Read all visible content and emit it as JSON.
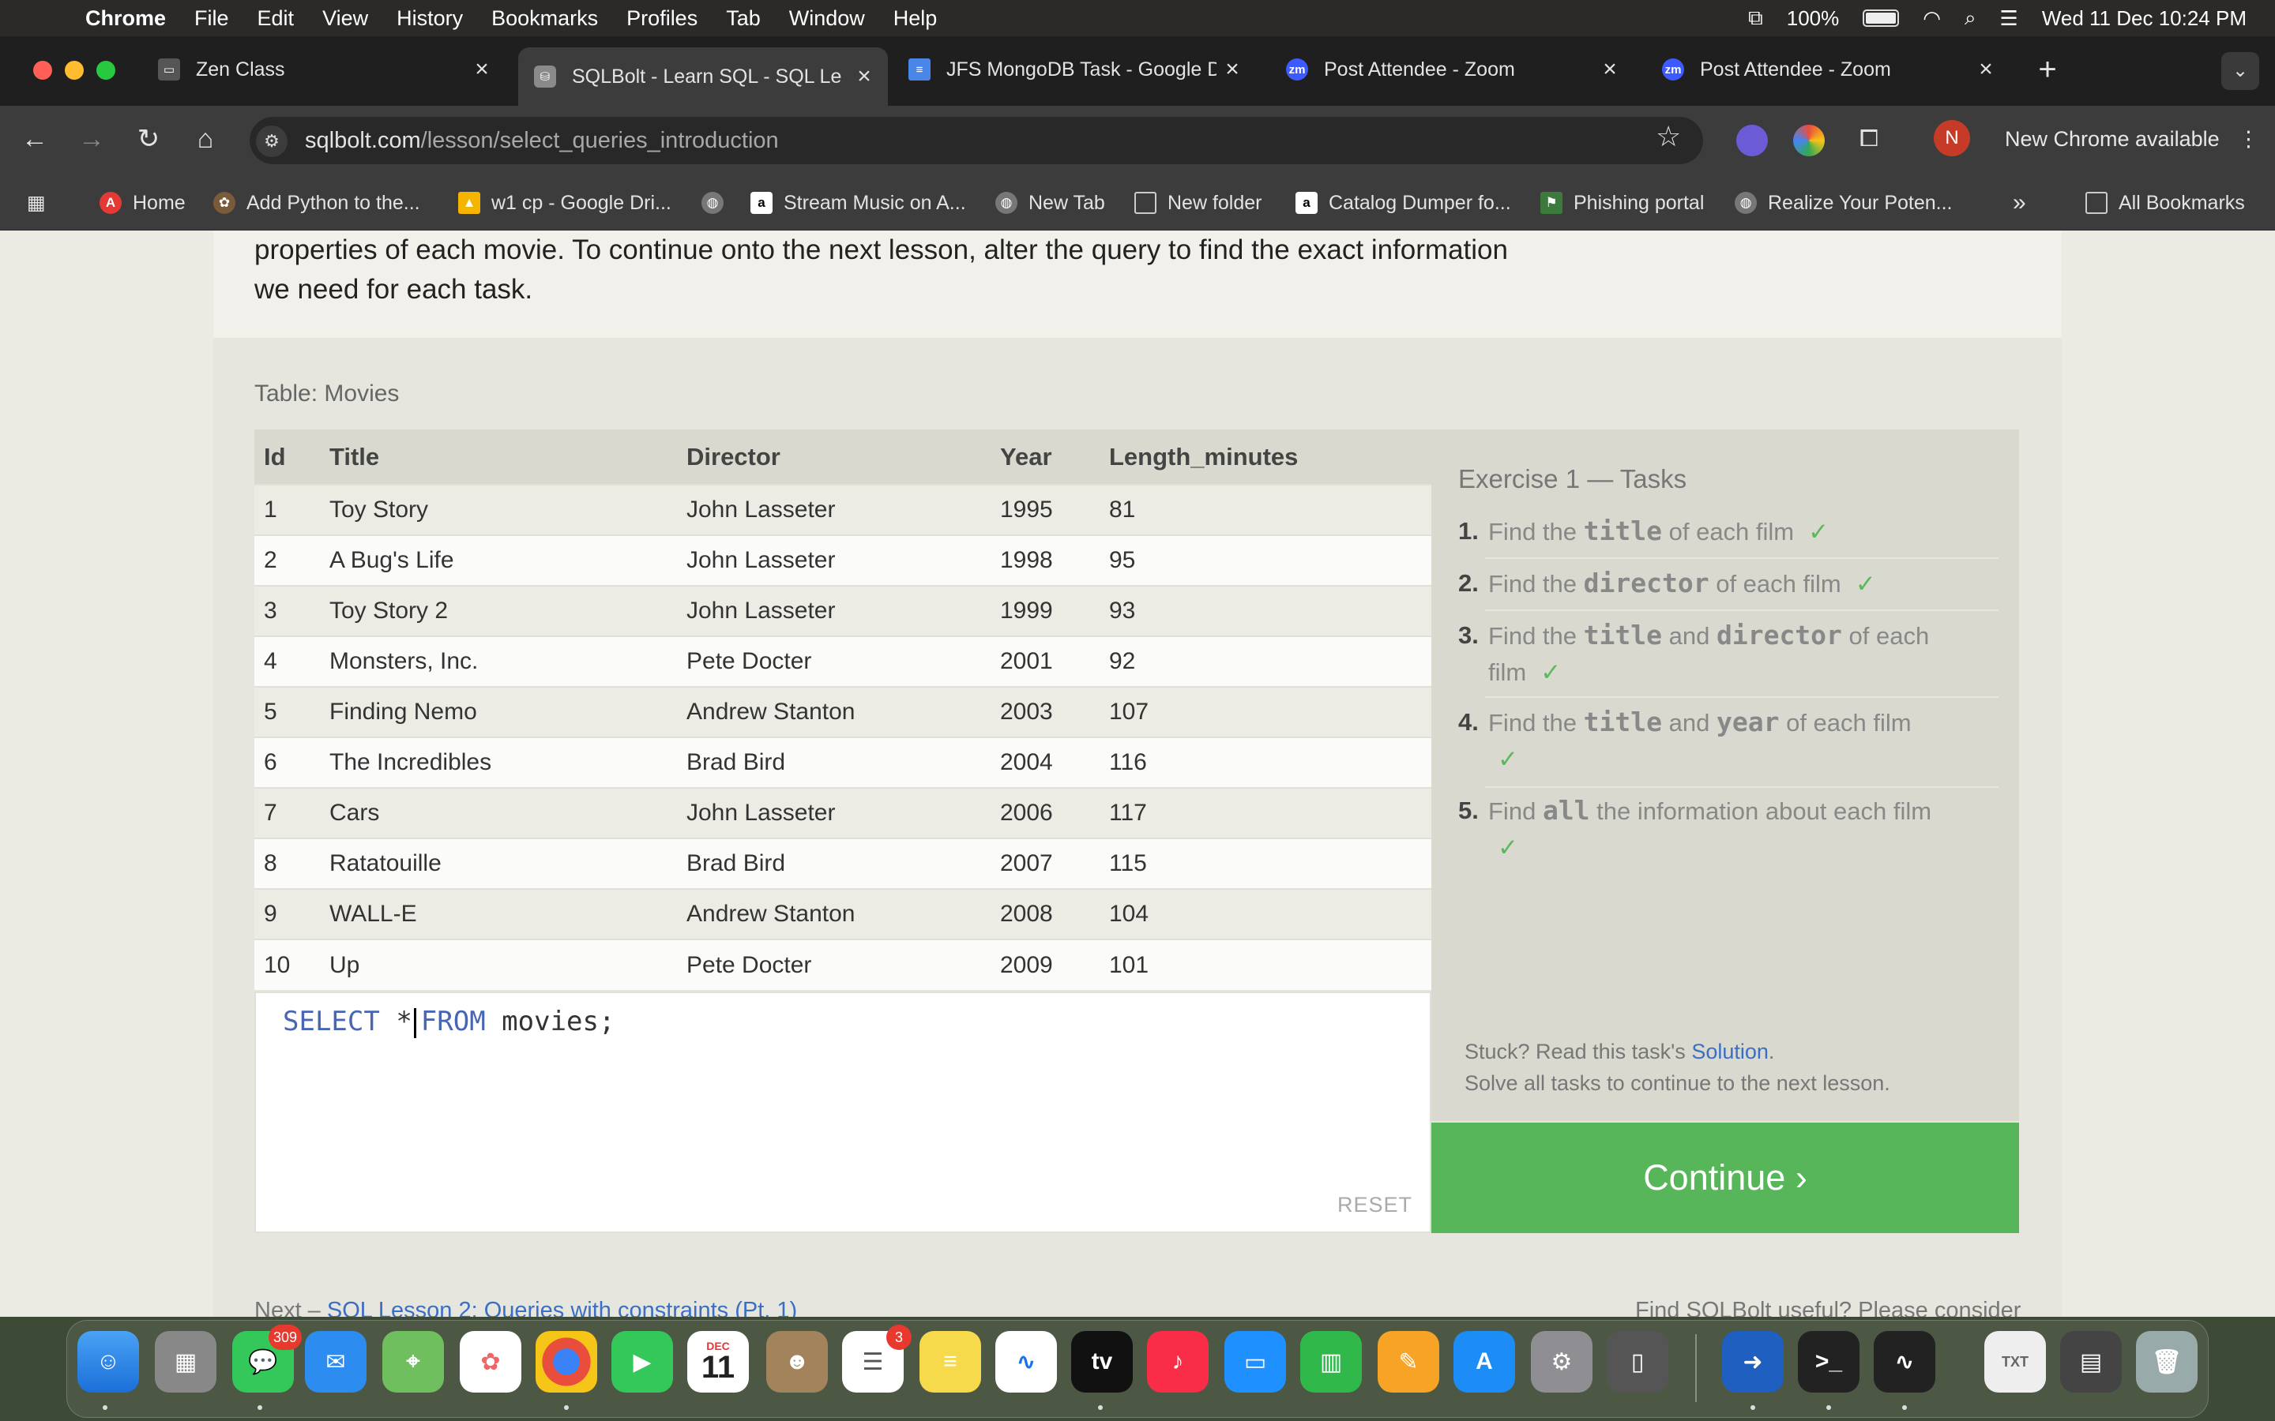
{
  "menubar": {
    "app": "Chrome",
    "items": [
      "File",
      "Edit",
      "View",
      "History",
      "Bookmarks",
      "Profiles",
      "Tab",
      "Window",
      "Help"
    ],
    "battery": "100%",
    "datetime": "Wed 11 Dec  10:24 PM"
  },
  "tabs": [
    {
      "label": "Zen Class",
      "icon": "zen-icon"
    },
    {
      "label": "SQLBolt - Learn SQL - SQL Le",
      "icon": "sqlbolt-icon"
    },
    {
      "label": "JFS MongoDB Task - Google D",
      "icon": "google-docs-icon"
    },
    {
      "label": "Post Attendee - Zoom",
      "icon": "zoom-icon"
    },
    {
      "label": "Post Attendee - Zoom",
      "icon": "zoom-icon"
    }
  ],
  "address": {
    "domain": "sqlbolt.com",
    "path": "/lesson/select_queries_introduction"
  },
  "toolbar": {
    "new_chrome": "New Chrome available",
    "profile_initial": "N"
  },
  "bookmarks": [
    {
      "label": "Home"
    },
    {
      "label": "Add Python to the..."
    },
    {
      "label": "w1 cp - Google Dri..."
    },
    {
      "label": ""
    },
    {
      "label": "Stream Music on A..."
    },
    {
      "label": "New Tab"
    },
    {
      "label": "New folder"
    },
    {
      "label": "Catalog Dumper fo..."
    },
    {
      "label": "Phishing portal"
    },
    {
      "label": "Realize Your Poten..."
    }
  ],
  "bookmarks_more": "»",
  "bookmarks_all": "All Bookmarks",
  "lesson": {
    "intro_line1": "properties of each movie. To continue onto the next lesson, alter the query to find the exact information",
    "intro_line2": "we need for each task.",
    "table_caption": "Table: Movies",
    "columns": [
      "Id",
      "Title",
      "Director",
      "Year",
      "Length_minutes"
    ],
    "rows": [
      [
        "1",
        "Toy Story",
        "John Lasseter",
        "1995",
        "81"
      ],
      [
        "2",
        "A Bug's Life",
        "John Lasseter",
        "1998",
        "95"
      ],
      [
        "3",
        "Toy Story 2",
        "John Lasseter",
        "1999",
        "93"
      ],
      [
        "4",
        "Monsters, Inc.",
        "Pete Docter",
        "2001",
        "92"
      ],
      [
        "5",
        "Finding Nemo",
        "Andrew Stanton",
        "2003",
        "107"
      ],
      [
        "6",
        "The Incredibles",
        "Brad Bird",
        "2004",
        "116"
      ],
      [
        "7",
        "Cars",
        "John Lasseter",
        "2006",
        "117"
      ],
      [
        "8",
        "Ratatouille",
        "Brad Bird",
        "2007",
        "115"
      ],
      [
        "9",
        "WALL-E",
        "Andrew Stanton",
        "2008",
        "104"
      ],
      [
        "10",
        "Up",
        "Pete Docter",
        "2009",
        "101"
      ]
    ],
    "query": {
      "kw1": "SELECT",
      "star": "*",
      "kw2": "FROM",
      "rest": "movies;"
    },
    "reset": "RESET",
    "tasks_title": "Exercise 1 — Tasks",
    "tasks": [
      {
        "num": "1.",
        "pre": "Find the",
        "mono1": "title",
        "mid": "",
        "mono2": "",
        "post": "of each film",
        "check": "✓"
      },
      {
        "num": "2.",
        "pre": "Find the",
        "mono1": "director",
        "mid": "",
        "mono2": "",
        "post": "of each film",
        "check": "✓"
      },
      {
        "num": "3.",
        "pre": "Find the",
        "mono1": "title",
        "mid": "and",
        "mono2": "director",
        "post": "of each film",
        "check": "✓"
      },
      {
        "num": "4.",
        "pre": "Find the",
        "mono1": "title",
        "mid": "and",
        "mono2": "year",
        "post": "of each film",
        "check": "✓"
      },
      {
        "num": "5.",
        "pre": "Find",
        "mono1": "all",
        "mid": "",
        "mono2": "",
        "post": "the information about each film",
        "check": "✓"
      }
    ],
    "stuck_pre": "Stuck? Read this task's",
    "stuck_link": "Solution",
    "stuck_post": ".",
    "solve_all": "Solve all tasks to continue to the next lesson.",
    "continue": "Continue ›",
    "footer_next_label": "Next –",
    "footer_next_link": "SQL Lesson 2: Queries with constraints (Pt. 1)",
    "footer_right": "Find SQLBolt useful? Please consider"
  },
  "dock": {
    "messages_badge": "309",
    "calendar_month": "DEC",
    "calendar_day": "11",
    "reminders_badge": "3"
  }
}
